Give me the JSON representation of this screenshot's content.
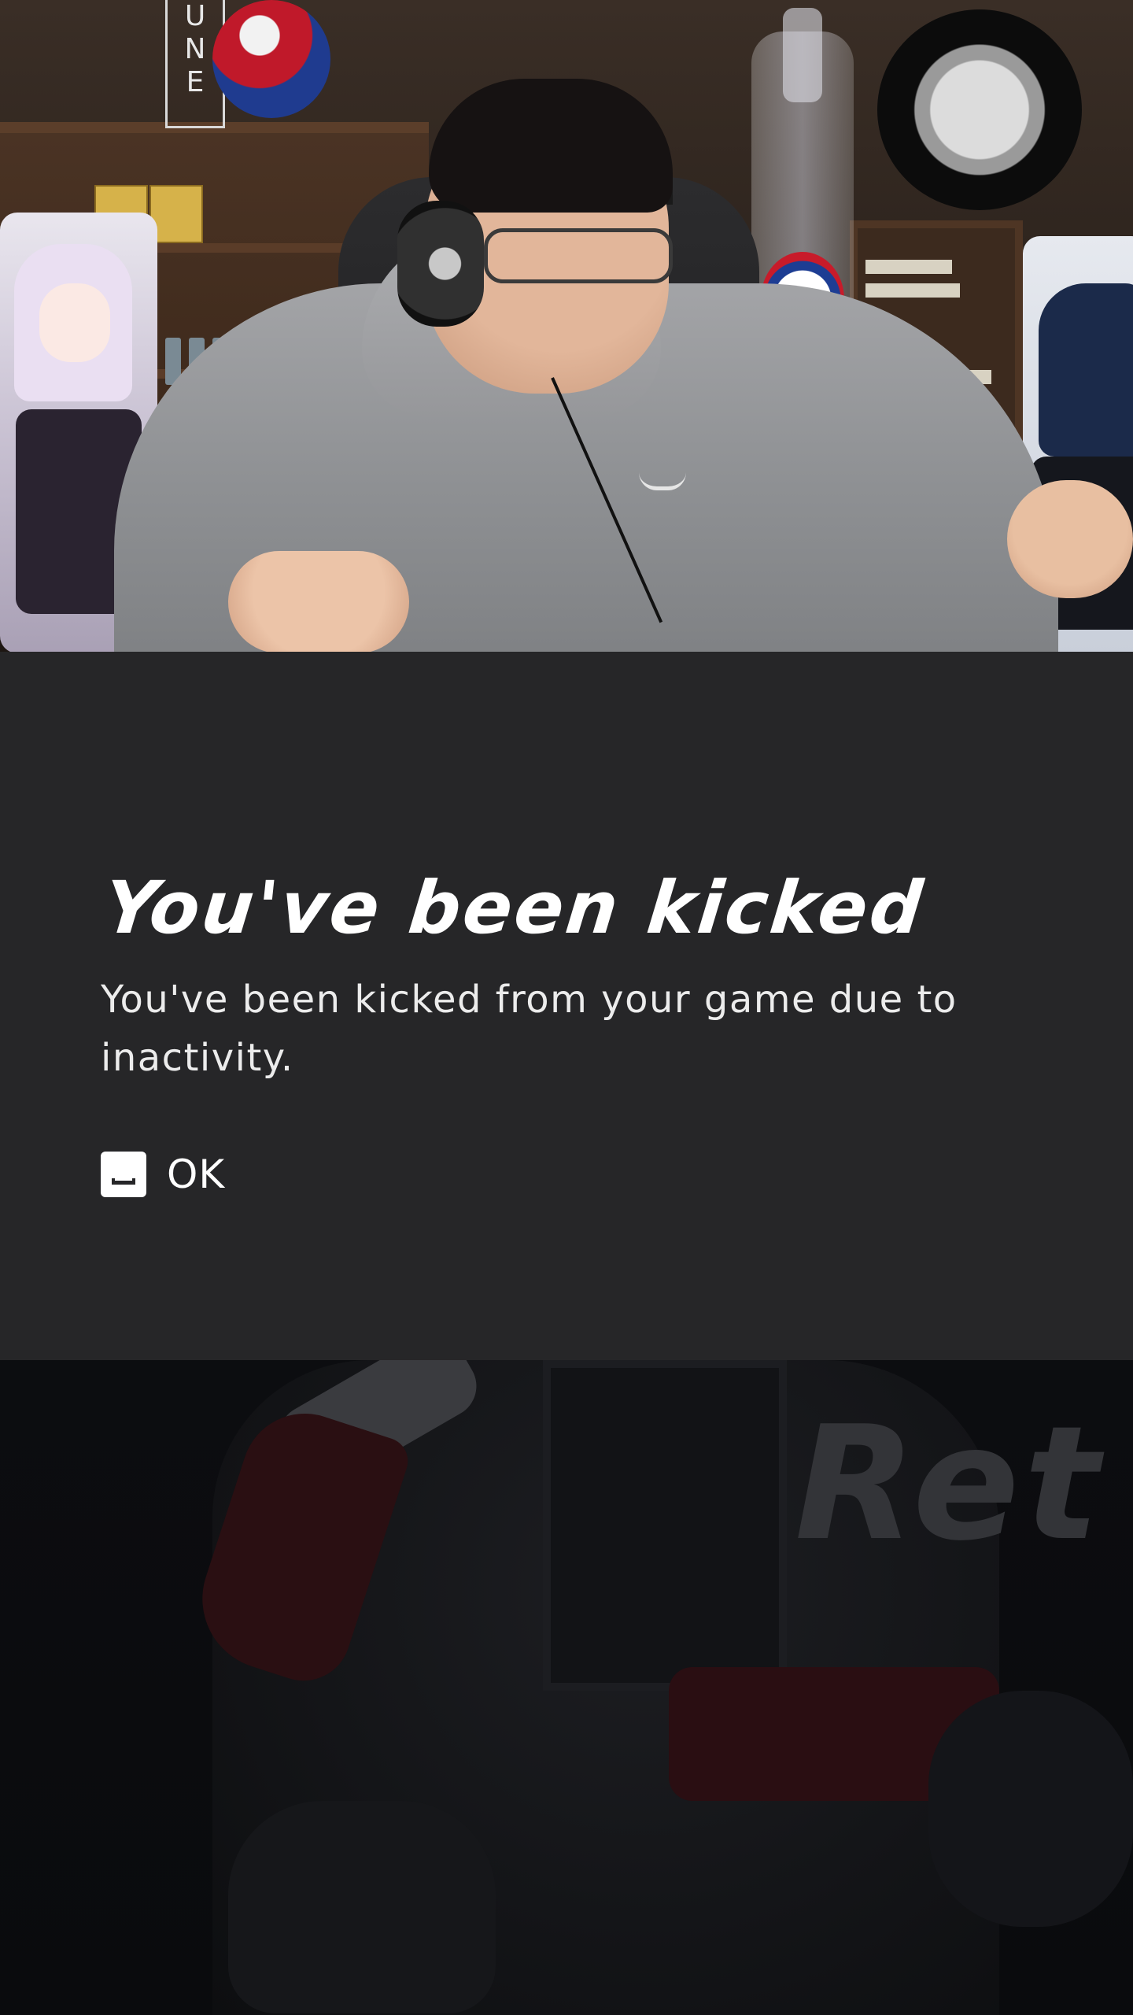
{
  "dialog": {
    "title": "You've been kicked",
    "message": "You've been kicked from your game due to inactivity.",
    "ok_button": {
      "label": "OK",
      "key_icon": "spacebar-key-icon"
    }
  },
  "background": {
    "text": "Ret"
  },
  "colors": {
    "dialog_background": "#262628",
    "title_text": "#ffffff",
    "message_text": "#ececec"
  }
}
